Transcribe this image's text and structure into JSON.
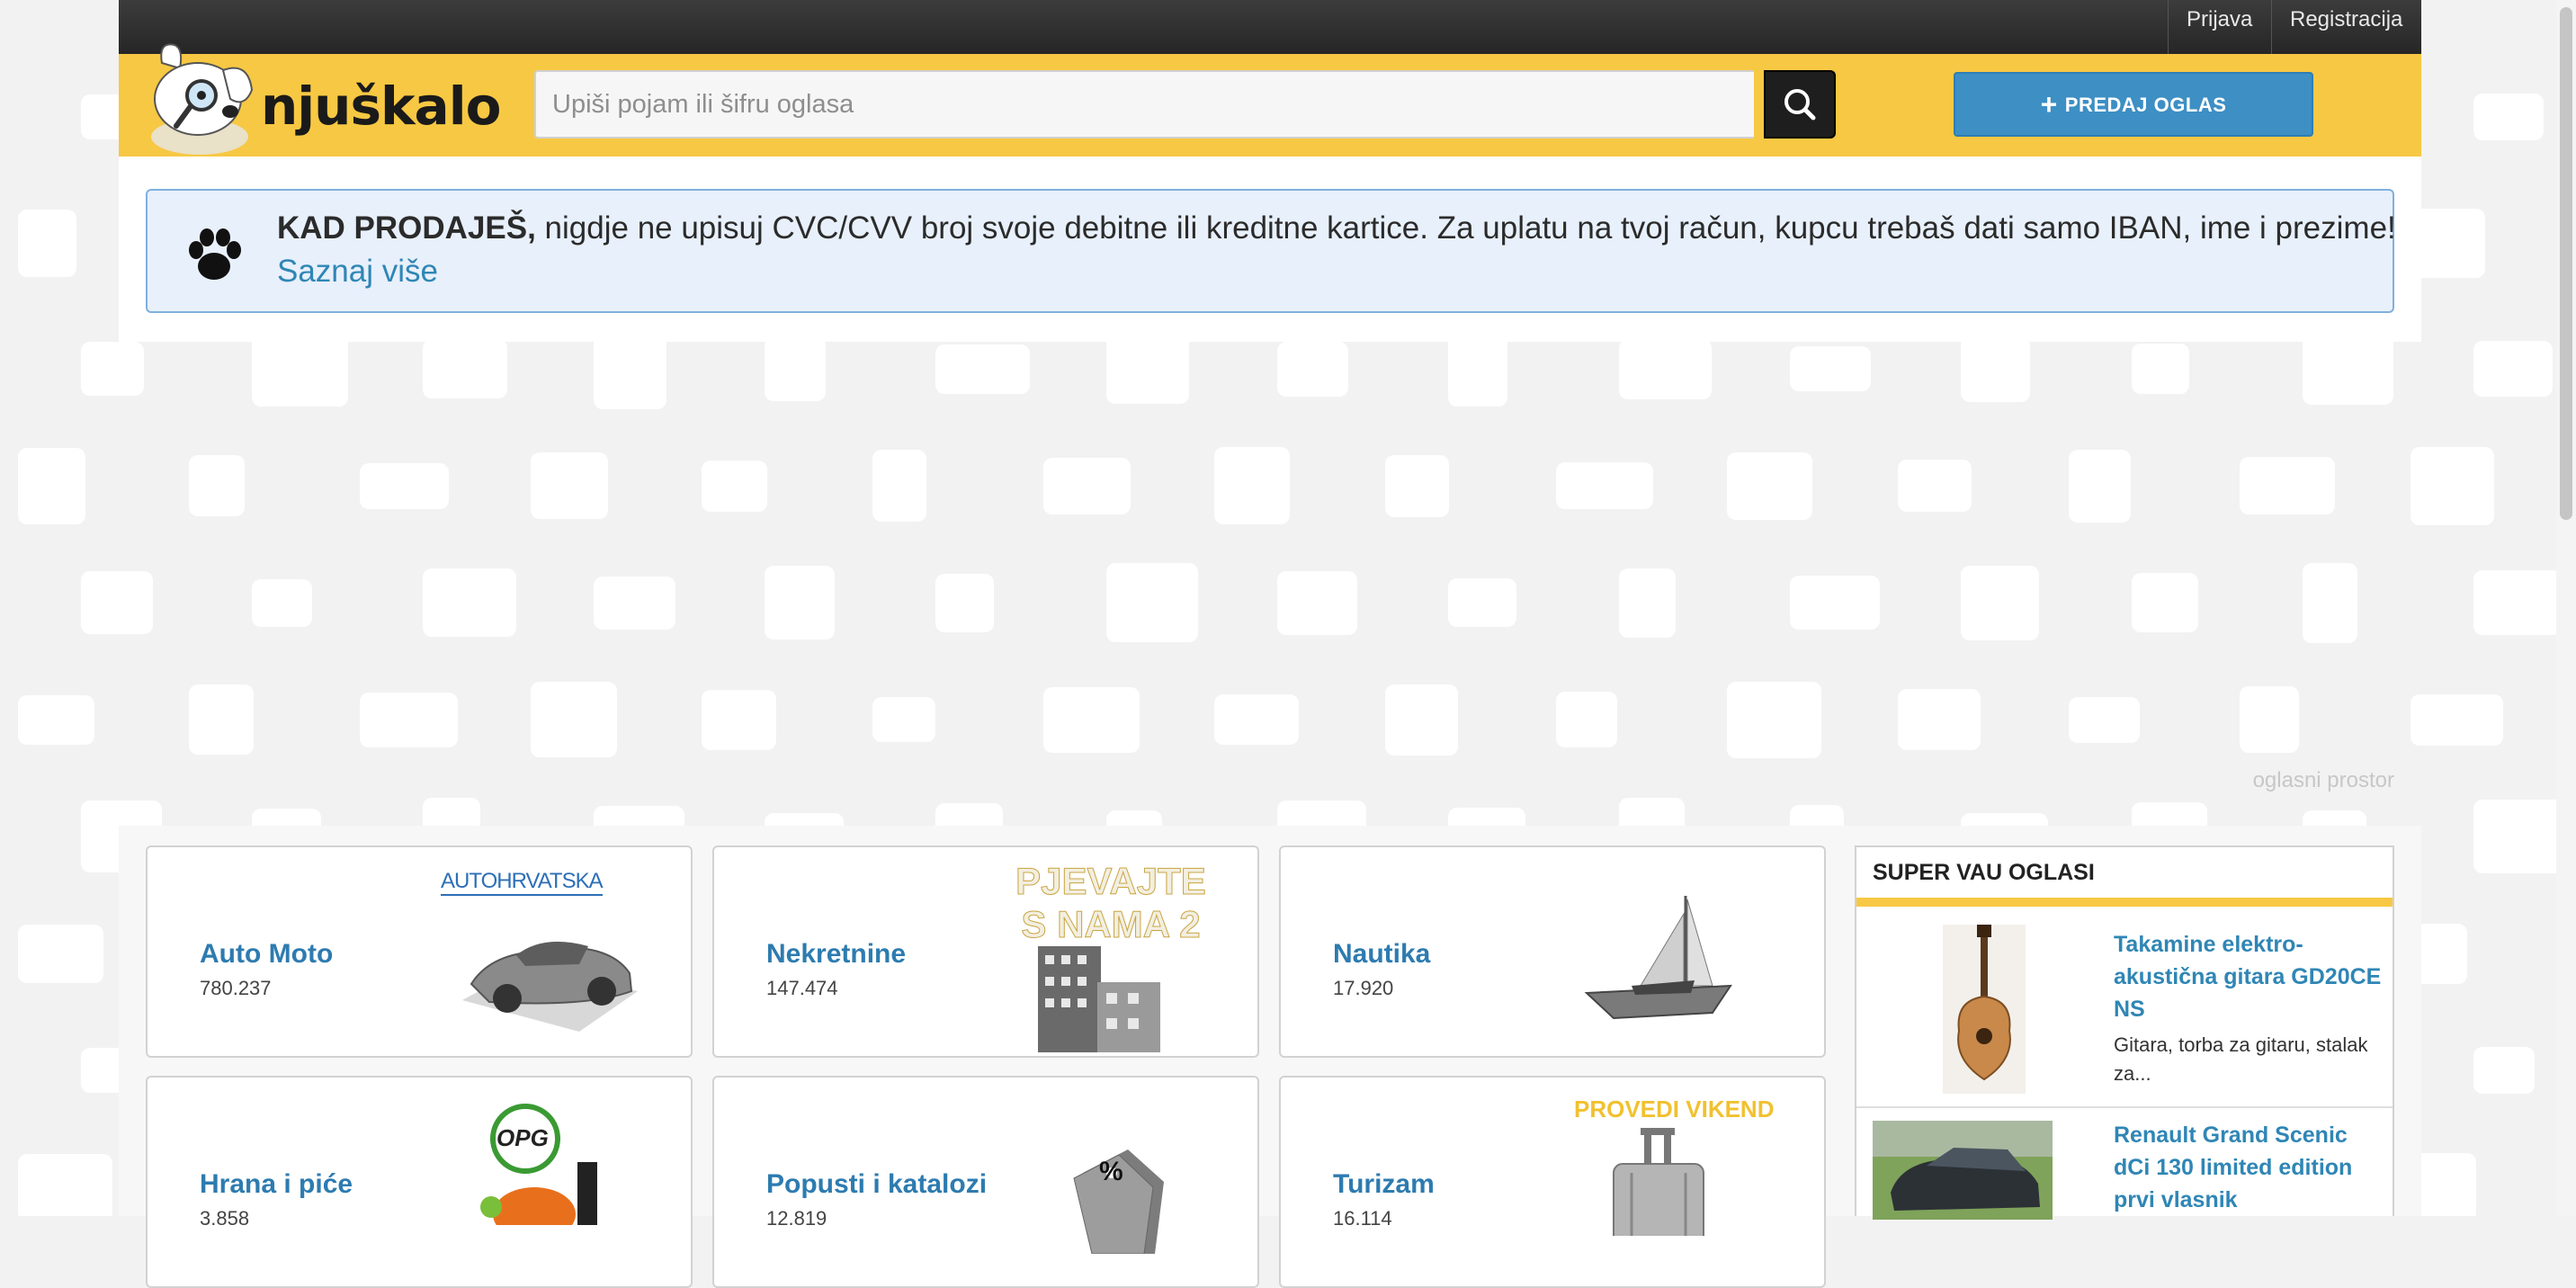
{
  "topbar": {
    "login": "Prijava",
    "register": "Registracija"
  },
  "logo": {
    "text": "njuškalo"
  },
  "search": {
    "placeholder": "Upiši pojam ili šifru oglasa",
    "button_icon": "search-icon"
  },
  "header": {
    "sell_button": "PREDAJ OGLAS"
  },
  "notice": {
    "bold": "KAD PRODAJEŠ,",
    "text": " nigdje ne upisuj CVC/CVV broj svoje debitne ili kreditne kartice. Za uplatu na tvoj račun, kupcu trebaš dati samo IBAN, ime i prezime!",
    "link": "Saznaj više"
  },
  "ad_space_label": "oglasni prostor",
  "categories": [
    {
      "name": "Auto Moto",
      "count": "780.237",
      "promo": "AUTOHRVATSKA"
    },
    {
      "name": "Nekretnine",
      "count": "147.474",
      "promo": "PJEVAJTE S NAMA 2"
    },
    {
      "name": "Nautika",
      "count": "17.920",
      "promo": ""
    },
    {
      "name": "Hrana i piće",
      "count": "3.858",
      "promo": "OPG"
    },
    {
      "name": "Popusti i katalozi",
      "count": "12.819",
      "promo": "%"
    },
    {
      "name": "Turizam",
      "count": "16.114",
      "promo": "PROVEDI VIKEND"
    }
  ],
  "super_vau": {
    "title": "SUPER VAU OGLASI",
    "items": [
      {
        "title": "Takamine elektro-akustična gitara GD20CE NS",
        "desc": "Gitara, torba za gitaru, stalak za..."
      },
      {
        "title": "Renault Grand Scenic dCi 130 limited edition prvi vlasnik",
        "desc": ""
      }
    ]
  },
  "colors": {
    "brand_yellow": "#f7c843",
    "link_blue": "#2f86b5",
    "button_blue": "#3d8fc4",
    "topbar_dark": "#2f2f2f"
  }
}
